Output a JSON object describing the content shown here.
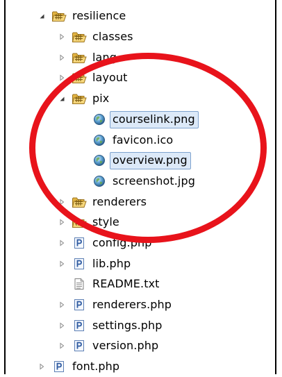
{
  "tree": {
    "rows": [
      {
        "label": "resilience",
        "icon": "folder-icon",
        "expander": "expanded"
      },
      {
        "label": "classes",
        "icon": "folder-icon",
        "expander": "collapsed"
      },
      {
        "label": "lang",
        "icon": "folder-icon",
        "expander": "collapsed"
      },
      {
        "label": "layout",
        "icon": "folder-icon",
        "expander": "collapsed"
      },
      {
        "label": "pix",
        "icon": "folder-icon",
        "expander": "expanded"
      },
      {
        "label": "courselink.png",
        "icon": "globe-file-icon",
        "expander": "none",
        "selected": true
      },
      {
        "label": "favicon.ico",
        "icon": "globe-file-icon",
        "expander": "none"
      },
      {
        "label": "overview.png",
        "icon": "globe-file-icon",
        "expander": "none",
        "selected": true
      },
      {
        "label": "screenshot.jpg",
        "icon": "globe-file-icon",
        "expander": "none"
      },
      {
        "label": "renderers",
        "icon": "folder-icon",
        "expander": "collapsed"
      },
      {
        "label": "style",
        "icon": "folder-icon",
        "expander": "collapsed"
      },
      {
        "label": "config.php",
        "icon": "php-file-icon",
        "expander": "collapsed"
      },
      {
        "label": "lib.php",
        "icon": "php-file-icon",
        "expander": "collapsed"
      },
      {
        "label": "README.txt",
        "icon": "text-file-icon",
        "expander": "none"
      },
      {
        "label": "renderers.php",
        "icon": "php-file-icon",
        "expander": "collapsed"
      },
      {
        "label": "settings.php",
        "icon": "php-file-icon",
        "expander": "collapsed"
      },
      {
        "label": "version.php",
        "icon": "php-file-icon",
        "expander": "collapsed"
      },
      {
        "label": "font.php",
        "icon": "php-file-icon",
        "expander": "collapsed"
      }
    ]
  },
  "colors": {
    "highlight_ring": "#e8131b",
    "selection_fill": "#dce9f8",
    "selection_border": "#7da2ce"
  }
}
